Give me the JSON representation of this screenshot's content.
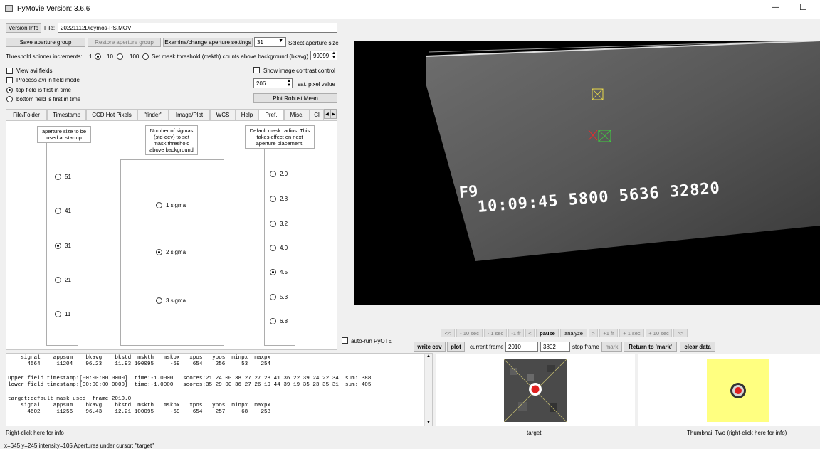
{
  "window": {
    "title": "PyMovie  Version: 3.6.6",
    "minimize": "—",
    "maximize": "☐"
  },
  "top": {
    "version_info": "Version Info",
    "file_label": "File:",
    "file_value": "20221112Didymos-PS.MOV",
    "save_aperture_group": "Save aperture group",
    "restore_aperture_group": "Restore aperture group",
    "examine_apertures": "Examine/change aperture settings",
    "aperture_size_value": "31",
    "select_aperture_size": "Select aperture size",
    "threshold_label": "Threshold spinner increments:",
    "inc_1": "1",
    "inc_10": "10",
    "inc_100": "100",
    "set_mask_threshold": "Set mask threshold (mskth) counts above background (bkavg)",
    "mask_threshold_value": "99999",
    "view_avi_fields": "View avi fields",
    "process_avi_in_field_mode": "Process avi in field mode",
    "top_field_first": "top field is first in time",
    "bottom_field_first": "bottom field is first in time",
    "show_image_contrast": "Show image contrast control",
    "sat_pixel_value": "206",
    "sat_pixel_label": "sat. pixel value",
    "plot_robust_mean": "Plot Robust Mean"
  },
  "tabs": [
    "File/Folder",
    "Timestamp",
    "CCD Hot Pixels",
    "\"finder\"",
    "Image/Plot",
    "WCS",
    "Help",
    "Pref.",
    "Misc.",
    "Cl"
  ],
  "pref": {
    "aperture_header": "aperture size to be used at startup",
    "aperture_options": [
      "51",
      "41",
      "31",
      "21",
      "11"
    ],
    "sigma_header": "Number of sigmas (std-dev) to set mask threshold above background",
    "sigma_options": [
      "1 sigma",
      "2 sigma",
      "3 sigma"
    ],
    "mask_header": "Default mask radius. This takes effect on next aperture placement.",
    "mask_options": [
      "2.0",
      "2.8",
      "3.2",
      "4.0",
      "4.5",
      "5.3",
      "6.8"
    ]
  },
  "image": {
    "overlay_line1": "F9",
    "overlay_line2": "10:09:45 5800 5636 32820"
  },
  "controls": {
    "nav_buttons": [
      "<<",
      "- 10 sec",
      "- 1 sec",
      "-1 fr",
      "<",
      "pause",
      "analyze",
      ">",
      "+1 fr",
      "+ 1 sec",
      "+ 10 sec",
      ">>"
    ],
    "auto_run_pyote": "auto-run PyOTE",
    "write_csv": "write csv",
    "plot": "plot",
    "current_frame_label": "current frame",
    "current_frame_value": "2010",
    "stop_frame_value": "3802",
    "stop_frame_label": "stop frame",
    "mark": "mark",
    "return_to_mark": "Return to 'mark'",
    "clear_data": "clear data"
  },
  "log": {
    "lines": [
      "    signal    appsum    bkavg    bkstd  mskth   mskpx   xpos   ypos  minpx  maxpx",
      "      4564     11204    96.23    11.93 100095     -69    654    256     53    254",
      "",
      "upper field timestamp:[00:00:00.0000]  time:-1.0000   scores:21 24 00 38 27 27 28 41 36 22 39 24 22 34  sum: 388",
      "lower field timestamp:[00:00:00.0000]  time:-1.0000   scores:35 29 00 36 27 26 19 44 39 19 35 23 35 31  sum: 405",
      "",
      "target:default mask used  frame:2010.0",
      "    signal    appsum    bkavg    bkstd  mskth   mskpx   xpos   ypos  minpx  maxpx",
      "      4602     11256    96.43    12.21 100095     -69    654    257     68    253"
    ]
  },
  "status": {
    "right_click_info": "Right-click here for info",
    "target_label": "target",
    "thumbnail_two_label": "Thumbnail Two (right-click here for info)",
    "cursor_readout": "x=645 y=245 intensity=105   Apertures under cursor: \"target\""
  }
}
